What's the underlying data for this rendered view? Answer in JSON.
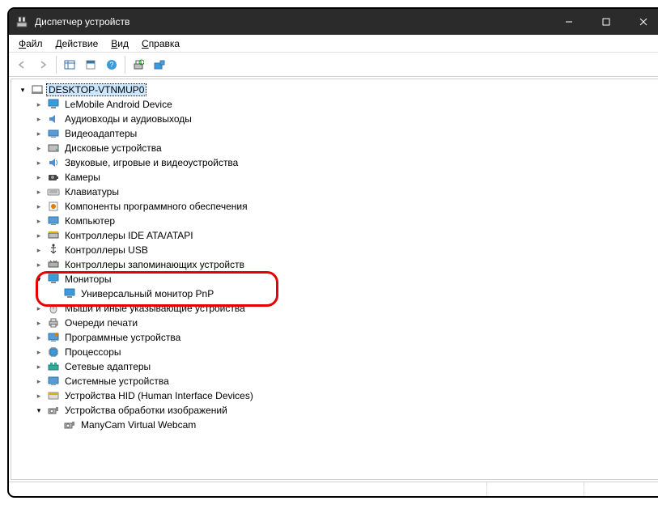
{
  "window": {
    "title": "Диспетчер устройств"
  },
  "menu": {
    "file": "Файл",
    "action": "Действие",
    "view": "Вид",
    "help": "Справка"
  },
  "tree": {
    "root": "DESKTOP-VTNMUP0",
    "cat": {
      "lemobile": "LeMobile Android Device",
      "audio": "Аудиовходы и аудиовыходы",
      "video": "Видеоадаптеры",
      "disk": "Дисковые устройства",
      "sound": "Звуковые, игровые и видеоустройства",
      "camera": "Камеры",
      "keyboard": "Клавиатуры",
      "software": "Компоненты программного обеспечения",
      "computer": "Компьютер",
      "ide": "Контроллеры IDE ATA/ATAPI",
      "usb": "Контроллеры USB",
      "storage": "Контроллеры запоминающих устройств",
      "monitors": "Мониторы",
      "monitor_pnp": "Универсальный монитор PnP",
      "mouse": "Мыши и иные указывающие устройства",
      "print": "Очереди печати",
      "swdev": "Программные устройства",
      "cpu": "Процессоры",
      "net": "Сетевые адаптеры",
      "system": "Системные устройства",
      "hid": "Устройства HID (Human Interface Devices)",
      "imaging": "Устройства обработки изображений",
      "manycam": "ManyCam Virtual Webcam"
    }
  }
}
